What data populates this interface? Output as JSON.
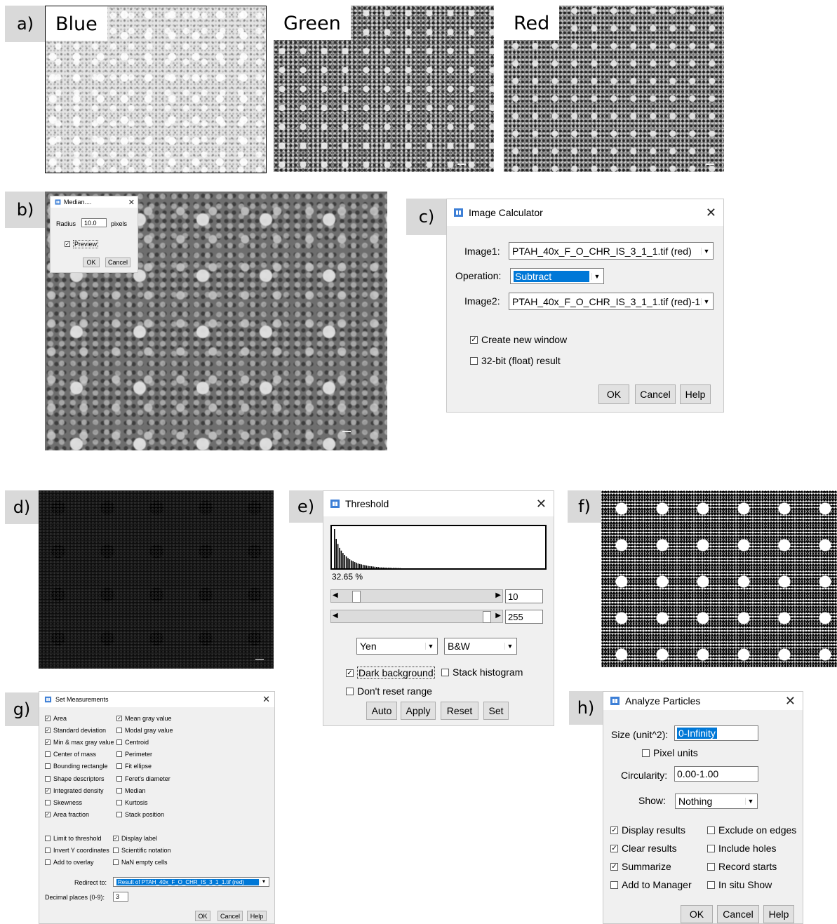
{
  "panels": {
    "a": "a)",
    "b": "b)",
    "c": "c)",
    "d": "d)",
    "e": "e)",
    "f": "f)",
    "g": "g)",
    "h": "h)"
  },
  "channel_labels": [
    "Blue",
    "Green",
    "Red"
  ],
  "median_dialog": {
    "title": "Median....",
    "radius_label": "Radius",
    "radius_value": "10.0",
    "radius_unit": "pixels",
    "preview_label": "Preview",
    "ok": "OK",
    "cancel": "Cancel"
  },
  "image_calculator": {
    "title": "Image Calculator",
    "image1_label": "Image1:",
    "image1_value": "PTAH_40x_F_O_CHR_IS_3_1_1.tif (red)",
    "operation_label": "Operation:",
    "operation_value": "Subtract",
    "image2_label": "Image2:",
    "image2_value": "PTAH_40x_F_O_CHR_IS_3_1_1.tif (red)-1",
    "create_new_window": "Create new window",
    "float_result": "32-bit (float) result",
    "ok": "OK",
    "cancel": "Cancel",
    "help": "Help"
  },
  "threshold": {
    "title": "Threshold",
    "percent": "32.65 %",
    "min_value": "10",
    "max_value": "255",
    "method": "Yen",
    "mode": "B&W",
    "dark_background": "Dark background",
    "stack_histogram": "Stack histogram",
    "dont_reset_range": "Don't reset range",
    "auto": "Auto",
    "apply": "Apply",
    "reset": "Reset",
    "set": "Set",
    "histogram": [
      1.0,
      0.75,
      0.62,
      0.52,
      0.45,
      0.39,
      0.34,
      0.3,
      0.26,
      0.23,
      0.2,
      0.18,
      0.16,
      0.14,
      0.12,
      0.11,
      0.1,
      0.09,
      0.08,
      0.07,
      0.06,
      0.055,
      0.05,
      0.045,
      0.04,
      0.035,
      0.03,
      0.026,
      0.023,
      0.02,
      0.018,
      0.016,
      0.014,
      0.012,
      0.01,
      0.009,
      0.008,
      0.007,
      0.006,
      0.005
    ]
  },
  "set_measurements": {
    "title": "Set Measurements",
    "left_items": [
      {
        "label": "Area",
        "checked": true
      },
      {
        "label": "Standard deviation",
        "checked": true
      },
      {
        "label": "Min & max gray value",
        "checked": true
      },
      {
        "label": "Center of mass",
        "checked": false
      },
      {
        "label": "Bounding rectangle",
        "checked": false
      },
      {
        "label": "Shape descriptors",
        "checked": false
      },
      {
        "label": "Integrated density",
        "checked": true
      },
      {
        "label": "Skewness",
        "checked": false
      },
      {
        "label": "Area fraction",
        "checked": true
      }
    ],
    "right_items": [
      {
        "label": "Mean gray value",
        "checked": true
      },
      {
        "label": "Modal gray value",
        "checked": false
      },
      {
        "label": "Centroid",
        "checked": false
      },
      {
        "label": "Perimeter",
        "checked": false
      },
      {
        "label": "Fit ellipse",
        "checked": false
      },
      {
        "label": "Feret's diameter",
        "checked": false
      },
      {
        "label": "Median",
        "checked": false
      },
      {
        "label": "Kurtosis",
        "checked": false
      },
      {
        "label": "Stack position",
        "checked": false
      }
    ],
    "left_items2": [
      {
        "label": "Limit to threshold",
        "checked": false
      },
      {
        "label": "Invert Y coordinates",
        "checked": false
      },
      {
        "label": "Add to overlay",
        "checked": false
      }
    ],
    "right_items2": [
      {
        "label": "Display label",
        "checked": true
      },
      {
        "label": "Scientific notation",
        "checked": false
      },
      {
        "label": "NaN empty cells",
        "checked": false
      }
    ],
    "redirect_label": "Redirect to:",
    "redirect_value": "Result of PTAH_40x_F_O_CHR_IS_3_1_1.tif (red)",
    "decimal_label": "Decimal places (0-9):",
    "decimal_value": "3",
    "ok": "OK",
    "cancel": "Cancel",
    "help": "Help"
  },
  "analyze_particles": {
    "title": "Analyze Particles",
    "size_label": "Size (unit^2):",
    "size_value": "0-Infinity",
    "pixel_units": "Pixel units",
    "circularity_label": "Circularity:",
    "circularity_value": "0.00-1.00",
    "show_label": "Show:",
    "show_value": "Nothing",
    "left_items": [
      {
        "label": "Display results",
        "checked": true
      },
      {
        "label": "Clear results",
        "checked": true
      },
      {
        "label": "Summarize",
        "checked": true
      },
      {
        "label": "Add to Manager",
        "checked": false
      }
    ],
    "right_items": [
      {
        "label": "Exclude on edges",
        "checked": false
      },
      {
        "label": "Include holes",
        "checked": false
      },
      {
        "label": "Record starts",
        "checked": false
      },
      {
        "label": "In situ Show",
        "checked": false
      }
    ],
    "ok": "OK",
    "cancel": "Cancel",
    "help": "Help"
  }
}
